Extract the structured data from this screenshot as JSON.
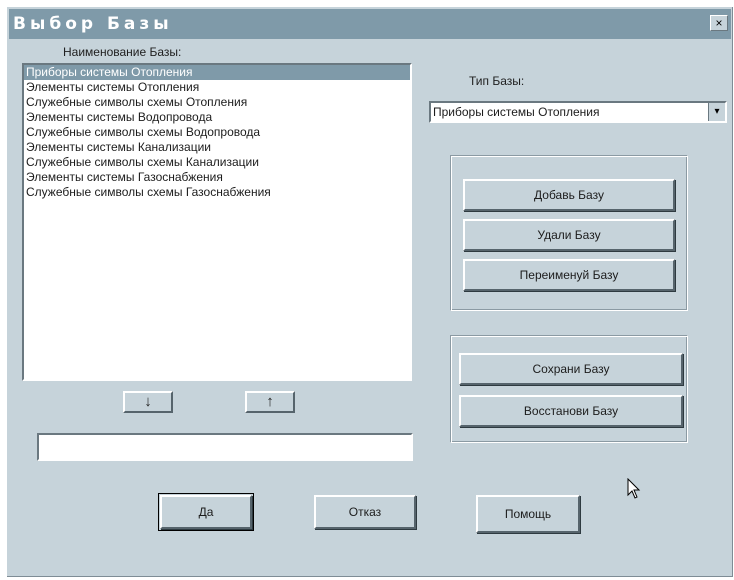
{
  "window": {
    "title": "Выбор Базы",
    "close_glyph": "×"
  },
  "left_panel": {
    "list_label": "Наименование Базы:",
    "items": [
      "Приборы системы Отопления",
      "Элементы системы Отопления",
      "Служебные символы схемы Отопления",
      "Элементы системы Водопровода",
      "Служебные символы схемы Водопровода",
      "Элементы системы Канализации",
      "Служебные символы схемы Канализации",
      "Элементы системы Газоснабжения",
      "Служебные символы схемы Газоснабжения"
    ],
    "selected_index": 0,
    "move_down_glyph": "↓",
    "move_up_glyph": "↑",
    "name_field_value": ""
  },
  "right_panel": {
    "type_label": "Тип Базы:",
    "type_selected": "Приборы системы Отопления",
    "dropdown_glyph": "▾",
    "add_button": "Добавь Базу",
    "delete_button": "Удали Базу",
    "rename_button": "Переименуй Базу",
    "save_button": "Сохрани Базу",
    "restore_button": "Восстанови Базу"
  },
  "footer": {
    "ok_button": "Да",
    "cancel_button": "Отказ",
    "help_button": "Помощь"
  }
}
